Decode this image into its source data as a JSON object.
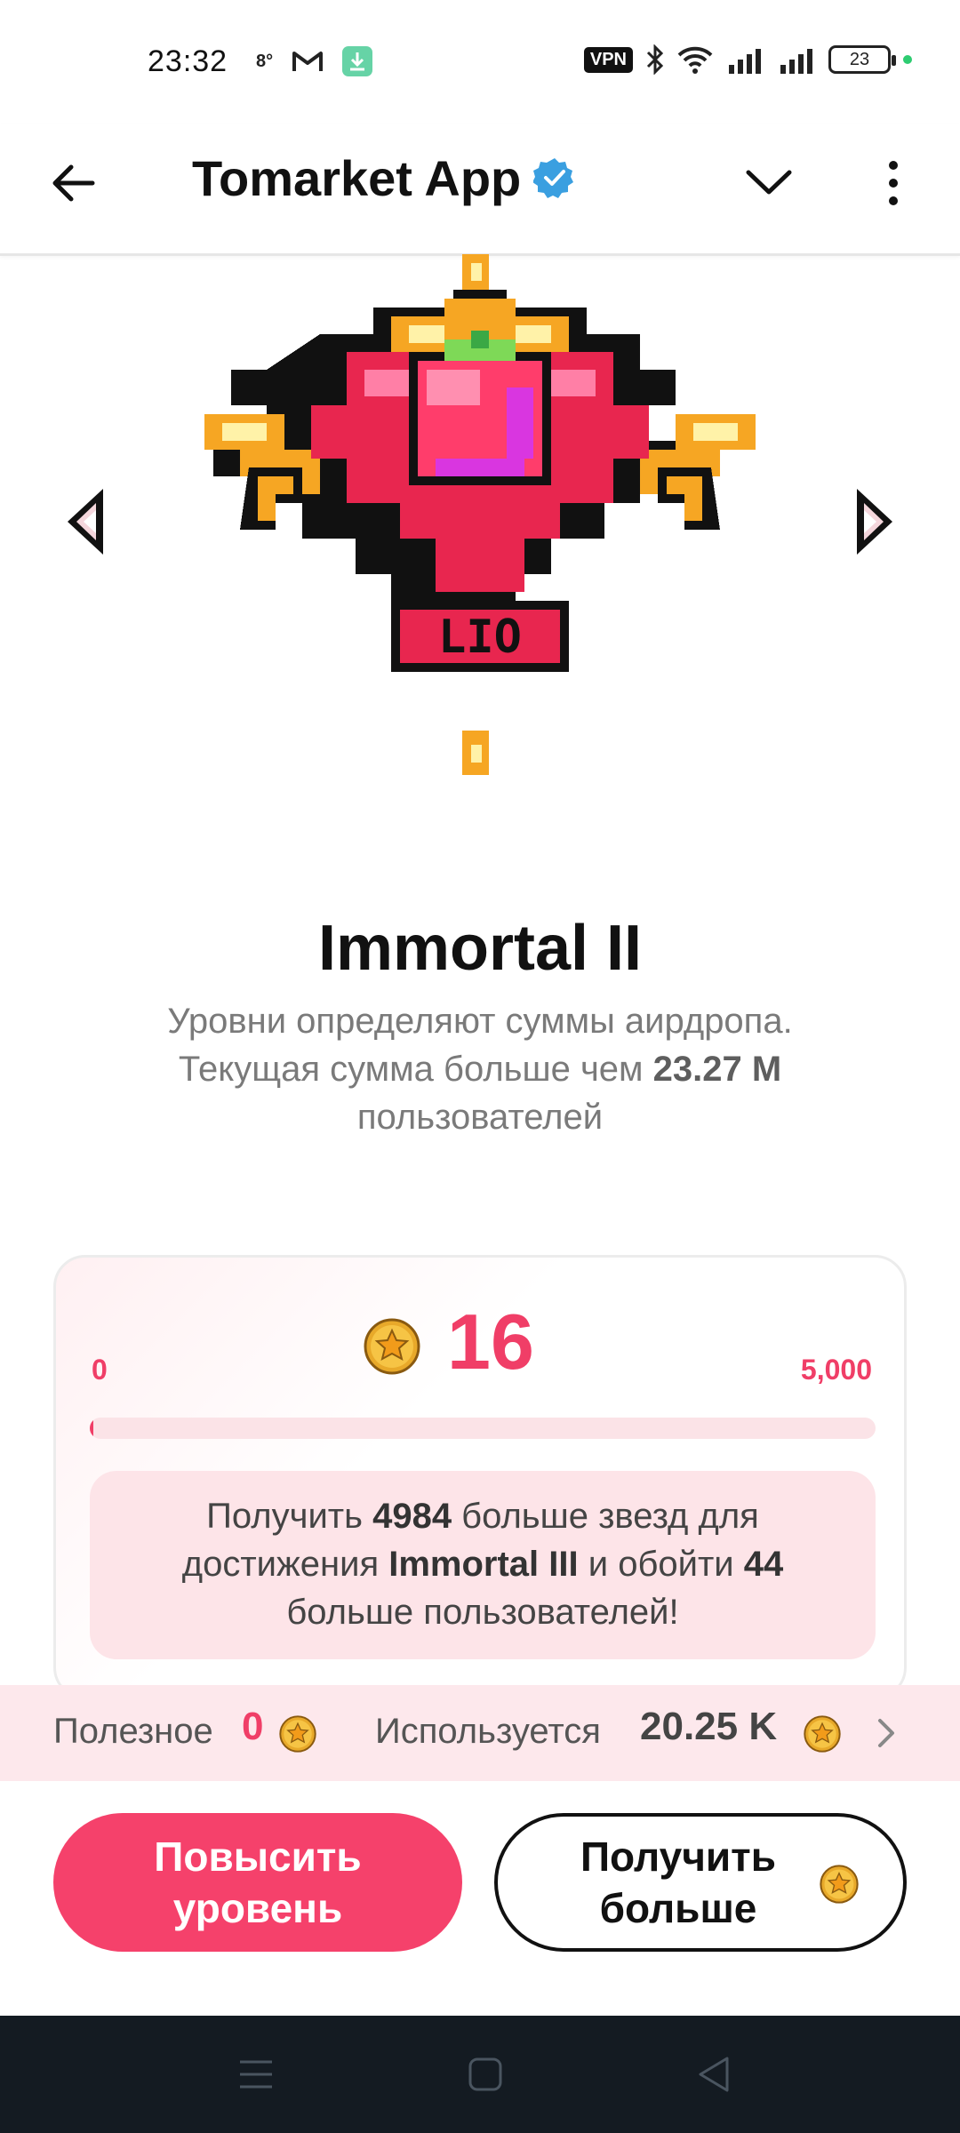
{
  "status_bar": {
    "time": "23:32",
    "temp": "8°",
    "vpn": "VPN",
    "battery": "23"
  },
  "header": {
    "title": "Tomarket App"
  },
  "rank": {
    "title": "Immortal II",
    "desc_line1": "Уровни определяют суммы аирдропа.",
    "desc_line2_prefix": "Текущая сумма больше чем ",
    "desc_line2_value": "23.27 M",
    "desc_line2_suffix": " пользователей",
    "badge_label": "LIO"
  },
  "progress": {
    "stars": "16",
    "min": "0",
    "max": "5,000",
    "fraction": 0.0032,
    "msg_part1": "Получить ",
    "msg_stars": "4984",
    "msg_part2": " больше звезд для достижения ",
    "msg_rank": "Immortal III",
    "msg_part3": " и обойти ",
    "msg_users": "44",
    "msg_part4": " больше пользователей!"
  },
  "info": {
    "useful_label": "Полезное",
    "useful_value": "0",
    "used_label": "Используется",
    "used_value": "20.25 K"
  },
  "buttons": {
    "upgrade": "Повысить уровень",
    "get_more": "Получить больше"
  },
  "colors": {
    "accent": "#f03e67",
    "button_primary": "#f5416b",
    "nav_bg": "#141b22"
  }
}
